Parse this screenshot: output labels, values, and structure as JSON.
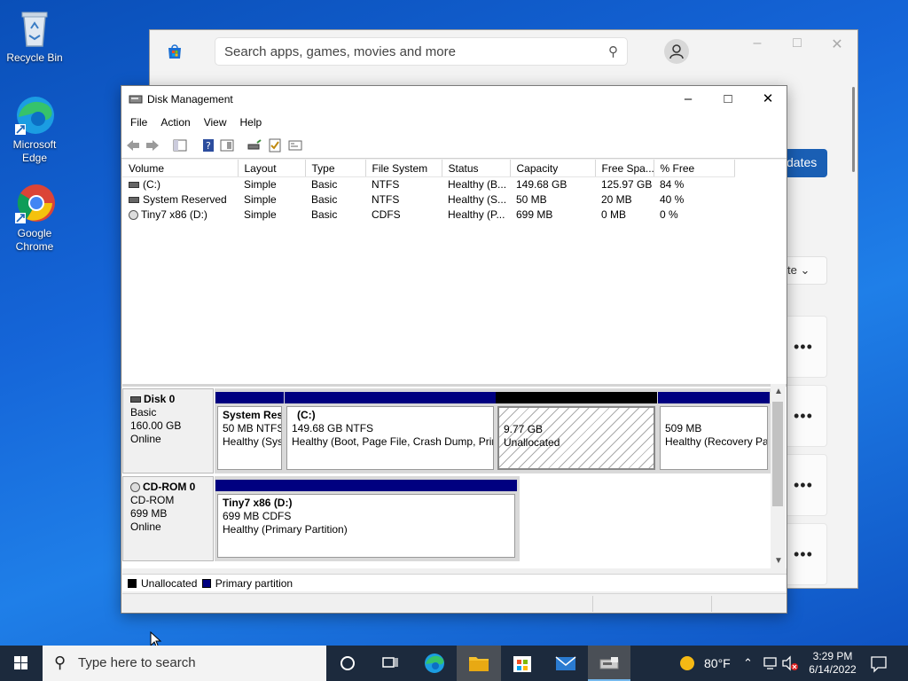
{
  "desktop": {
    "icons": [
      {
        "label": "Recycle Bin"
      },
      {
        "label": "Microsoft Edge"
      },
      {
        "label": "Google Chrome"
      }
    ]
  },
  "store": {
    "search_placeholder": "Search apps, games, movies and more",
    "updates_button_partial": "dates",
    "sort_partial": "te",
    "accent": "#1a5fb4"
  },
  "diskmgmt": {
    "title": "Disk Management",
    "menu": [
      "File",
      "Action",
      "View",
      "Help"
    ],
    "columns": [
      "Volume",
      "Layout",
      "Type",
      "File System",
      "Status",
      "Capacity",
      "Free Spa...",
      "% Free"
    ],
    "volumes": [
      {
        "volume": "(C:)",
        "layout": "Simple",
        "type": "Basic",
        "fs": "NTFS",
        "status": "Healthy (B...",
        "capacity": "149.68 GB",
        "free": "125.97 GB",
        "pct": "84 %",
        "icon": "drive-icon"
      },
      {
        "volume": "System Reserved",
        "layout": "Simple",
        "type": "Basic",
        "fs": "NTFS",
        "status": "Healthy (S...",
        "capacity": "50 MB",
        "free": "20 MB",
        "pct": "40 %",
        "icon": "drive-icon"
      },
      {
        "volume": "Tiny7 x86 (D:)",
        "layout": "Simple",
        "type": "Basic",
        "fs": "CDFS",
        "status": "Healthy (P...",
        "capacity": "699 MB",
        "free": "0 MB",
        "pct": "0 %",
        "icon": "cd-icon"
      }
    ],
    "disks": [
      {
        "name": "Disk 0",
        "kind": "Basic",
        "size": "160.00 GB",
        "state": "Online",
        "partitions": [
          {
            "title": "System Res",
            "line2": "50 MB NTFS",
            "line3": "Healthy (Sys"
          },
          {
            "title": "(C:)",
            "line2": "149.68 GB NTFS",
            "line3": "Healthy (Boot, Page File, Crash Dump, Prir"
          },
          {
            "title": "",
            "line2": "9.77 GB",
            "line3": "Unallocated"
          },
          {
            "title": "",
            "line2": "509 MB",
            "line3": "Healthy (Recovery Pa"
          }
        ]
      },
      {
        "name": "CD-ROM 0",
        "kind": "CD-ROM",
        "size": "699 MB",
        "state": "Online",
        "partitions": [
          {
            "title": "Tiny7 x86  (D:)",
            "line2": "699 MB CDFS",
            "line3": "Healthy (Primary Partition)"
          }
        ]
      }
    ],
    "legend": [
      {
        "label": "Unallocated",
        "color": "#000000"
      },
      {
        "label": "Primary partition",
        "color": "#000080"
      }
    ]
  },
  "taskbar": {
    "search_placeholder": "Type here to search",
    "weather": "80°F",
    "time": "3:29 PM",
    "date": "6/14/2022"
  }
}
